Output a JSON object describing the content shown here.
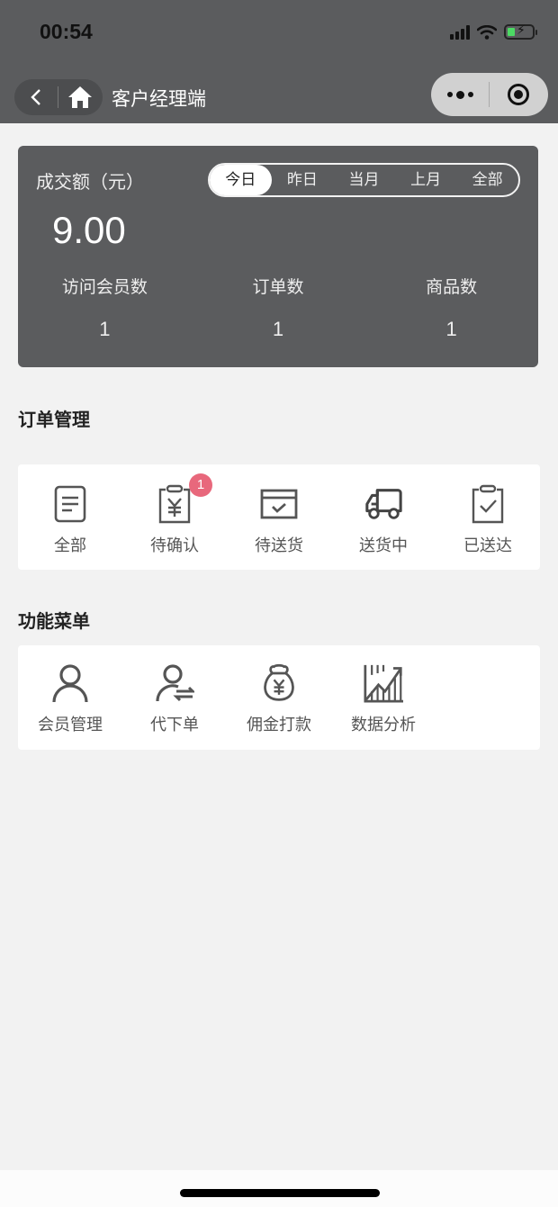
{
  "status_bar": {
    "time": "00:54"
  },
  "nav": {
    "title": "客户经理端"
  },
  "stats": {
    "amount_label": "成交额（元）",
    "amount": "9.00",
    "range_tabs": [
      {
        "label": "今日",
        "active": true
      },
      {
        "label": "昨日",
        "active": false
      },
      {
        "label": "当月",
        "active": false
      },
      {
        "label": "上月",
        "active": false
      },
      {
        "label": "全部",
        "active": false
      }
    ],
    "metrics": [
      {
        "label": "访问会员数",
        "value": "1"
      },
      {
        "label": "订单数",
        "value": "1"
      },
      {
        "label": "商品数",
        "value": "1"
      }
    ]
  },
  "orders": {
    "title": "订单管理",
    "items": [
      {
        "label": "全部",
        "icon": "document-list-icon"
      },
      {
        "label": "待确认",
        "icon": "clipboard-yen-icon",
        "badge": "1"
      },
      {
        "label": "待送货",
        "icon": "box-check-icon"
      },
      {
        "label": "送货中",
        "icon": "truck-icon"
      },
      {
        "label": "已送达",
        "icon": "clipboard-check-icon"
      }
    ]
  },
  "functions": {
    "title": "功能菜单",
    "items": [
      {
        "label": "会员管理",
        "icon": "user-icon"
      },
      {
        "label": "代下单",
        "icon": "user-exchange-icon"
      },
      {
        "label": "佣金打款",
        "icon": "money-bag-icon"
      },
      {
        "label": "数据分析",
        "icon": "chart-trend-icon"
      }
    ]
  },
  "colors": {
    "header": "#5b5c5e",
    "badge": "#e8687c",
    "background": "#f2f2f2"
  }
}
